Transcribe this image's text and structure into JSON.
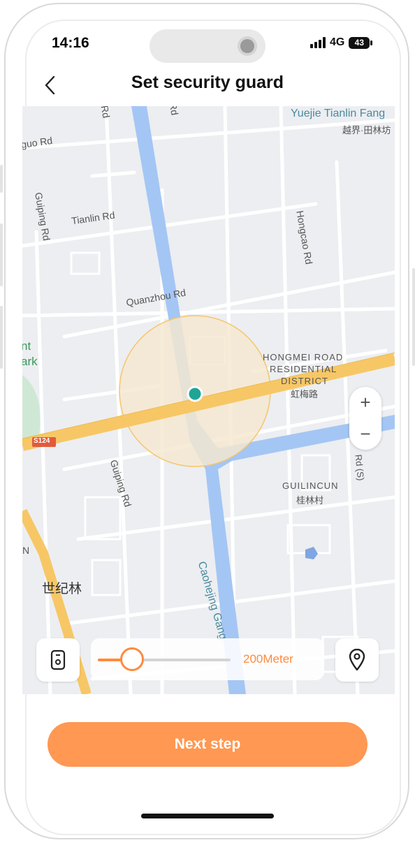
{
  "status_bar": {
    "time": "14:16",
    "network": "4G",
    "battery": "43"
  },
  "header": {
    "title": "Set security guard",
    "back_icon": "chevron-left-icon"
  },
  "map": {
    "labels": {
      "tianlin_fang_en": "Yuejie Tianlin Fang",
      "tianlin_fang_cn": "越界·田林坊",
      "guo_rd": "guo Rd",
      "guiping_rd_top": "Guiping Rd",
      "tianlin_rd": "Tianlin Rd",
      "hongcao_rd": "Hongcao Rd",
      "quanzhou_rd": "Quanzhou Rd",
      "park_1": "nt",
      "park_2": "ark",
      "hongmei_1": "HONGMEI ROAD",
      "hongmei_2": "RESIDENTIAL",
      "hongmei_3": "DISTRICT",
      "hongmei_cn": "虹梅路",
      "s124": "S124",
      "guiping_rd_bottom": "Guiping Rd",
      "guilincun_en": "GUILINCUN",
      "guilincun_cn": "桂林村",
      "rd_s": "Rd (S)",
      "caohejing": "Caohejing Gang",
      "shijilin": "世纪林",
      "n_letter": "N",
      "rd_top1": "Rd",
      "rd_top2": "Rd"
    },
    "zoom_in": "+",
    "zoom_out": "−",
    "geofence_color": "#f5c66b",
    "marker_color": "#1fa595"
  },
  "controls": {
    "device_icon": "watch-device-icon",
    "location_icon": "location-pin-icon",
    "radius_label": "200Meter",
    "radius_level": 0.26,
    "accent_color": "#ff8a3d"
  },
  "next_button": {
    "label": "Next step"
  }
}
